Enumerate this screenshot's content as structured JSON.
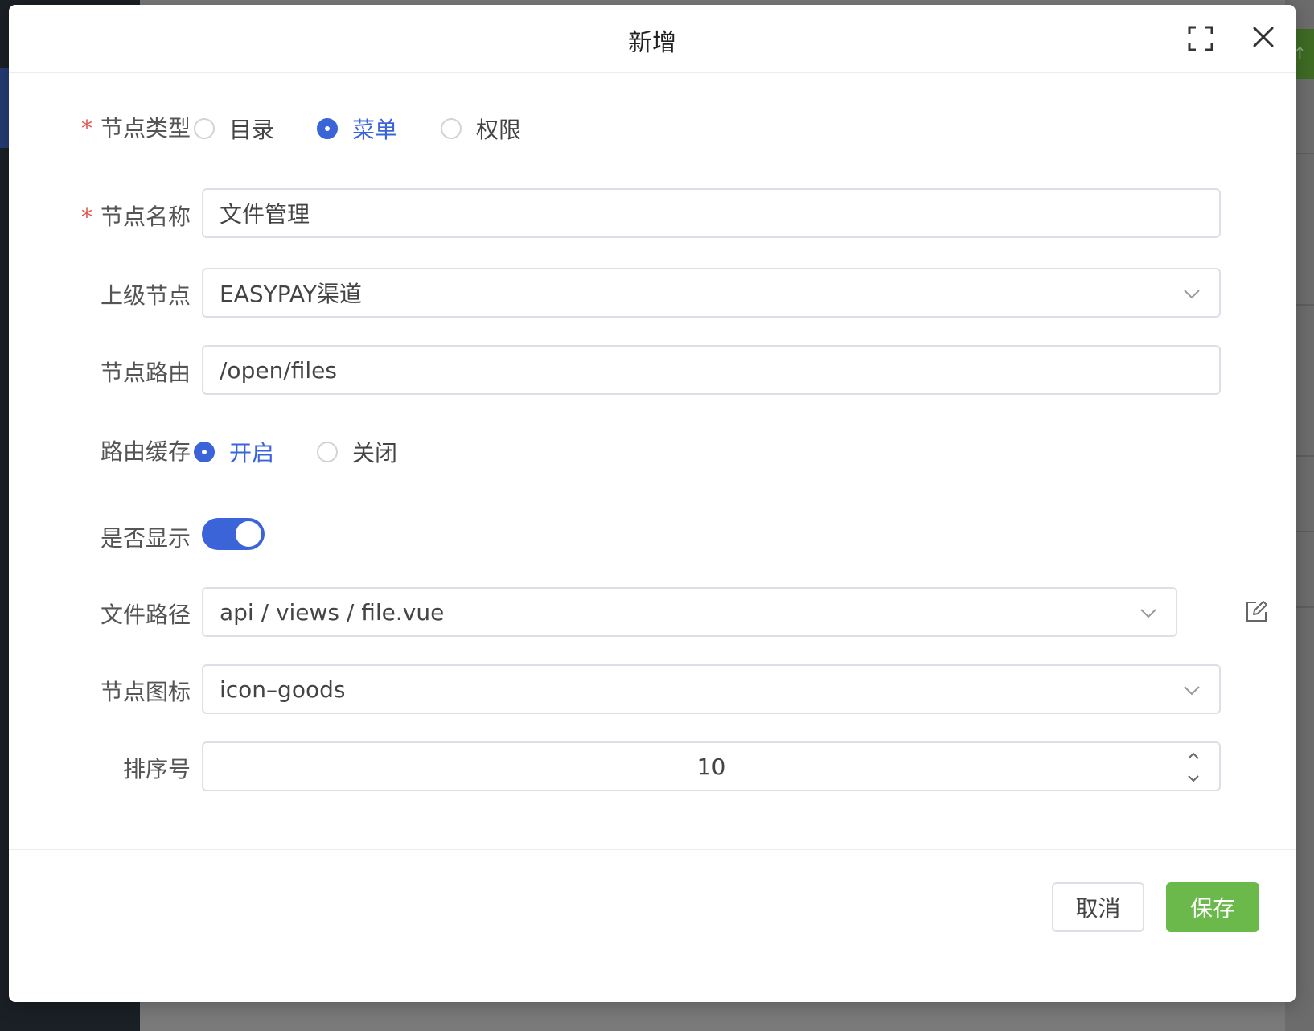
{
  "dialog": {
    "title": "新增",
    "fullscreen_icon": "fullscreen-icon",
    "close_icon": "close-icon"
  },
  "form": {
    "node_type": {
      "label": "节点类型",
      "required": true,
      "options": [
        {
          "label": "目录",
          "checked": false
        },
        {
          "label": "菜单",
          "checked": true
        },
        {
          "label": "权限",
          "checked": false
        }
      ]
    },
    "node_name": {
      "label": "节点名称",
      "required": true,
      "value": "文件管理"
    },
    "parent_node": {
      "label": "上级节点",
      "value": "EASYPAY渠道"
    },
    "node_route": {
      "label": "节点路由",
      "value": "/open/files"
    },
    "route_cache": {
      "label": "路由缓存",
      "options": [
        {
          "label": "开启",
          "checked": true
        },
        {
          "label": "关闭",
          "checked": false
        }
      ]
    },
    "visible": {
      "label": "是否显示",
      "on": true
    },
    "file_path": {
      "label": "文件路径",
      "value": "api / views / file.vue"
    },
    "node_icon": {
      "label": "节点图标",
      "value": "icon–goods"
    },
    "sort_no": {
      "label": "排序号",
      "value": "10"
    }
  },
  "footer": {
    "cancel_label": "取消",
    "save_label": "保存"
  },
  "colors": {
    "primary": "#3a64d8",
    "save": "#6ab94a",
    "required": "#e0564f"
  }
}
